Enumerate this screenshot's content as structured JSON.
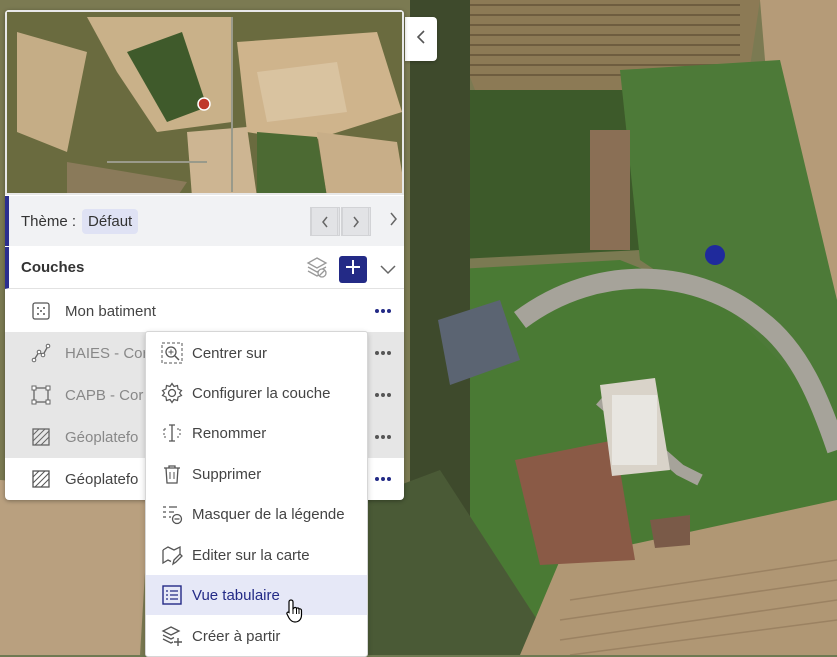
{
  "panel": {
    "collapse_icon": "chevron-left-icon",
    "theme": {
      "label": "Thème :",
      "value": "Défaut",
      "prev_icon": "chevron-left-icon",
      "next_icon": "chevron-right-icon",
      "expand_icon": "chevron-right-icon"
    },
    "layers": {
      "title": "Couches",
      "tools": [
        "layers-visibility-icon",
        "plus-icon",
        "chevron-down-icon"
      ],
      "items": [
        {
          "name": "Mon batiment",
          "icon": "polygon-dotted-icon",
          "state": "active"
        },
        {
          "name": "HAIES - Cor",
          "icon": "line-icon",
          "state": "greyed"
        },
        {
          "name": "CAPB - Cor",
          "icon": "polygon-icon",
          "state": "greyed"
        },
        {
          "name": "Géoplatefo",
          "icon": "hatched-polygon-icon",
          "state": "greyed"
        },
        {
          "name": "Géoplatefo",
          "icon": "hatched-polygon-icon",
          "state": "active"
        }
      ]
    }
  },
  "context_menu": {
    "items": [
      {
        "label": "Centrer sur",
        "icon": "zoom-center-icon"
      },
      {
        "label": "Configurer la couche",
        "icon": "gear-icon"
      },
      {
        "label": "Renommer",
        "icon": "rename-icon"
      },
      {
        "label": "Supprimer",
        "icon": "trash-icon"
      },
      {
        "label": "Masquer de la légende",
        "icon": "hide-legend-icon"
      },
      {
        "label": "Editer sur la carte",
        "icon": "edit-map-icon"
      },
      {
        "label": "Vue tabulaire",
        "icon": "table-view-icon",
        "highlighted": true
      },
      {
        "label": "Créer à partir",
        "icon": "create-from-icon"
      }
    ]
  },
  "colors": {
    "accent": "#232a86",
    "map_point": "#1f2a9c",
    "minimap_point": "#c0392b"
  }
}
